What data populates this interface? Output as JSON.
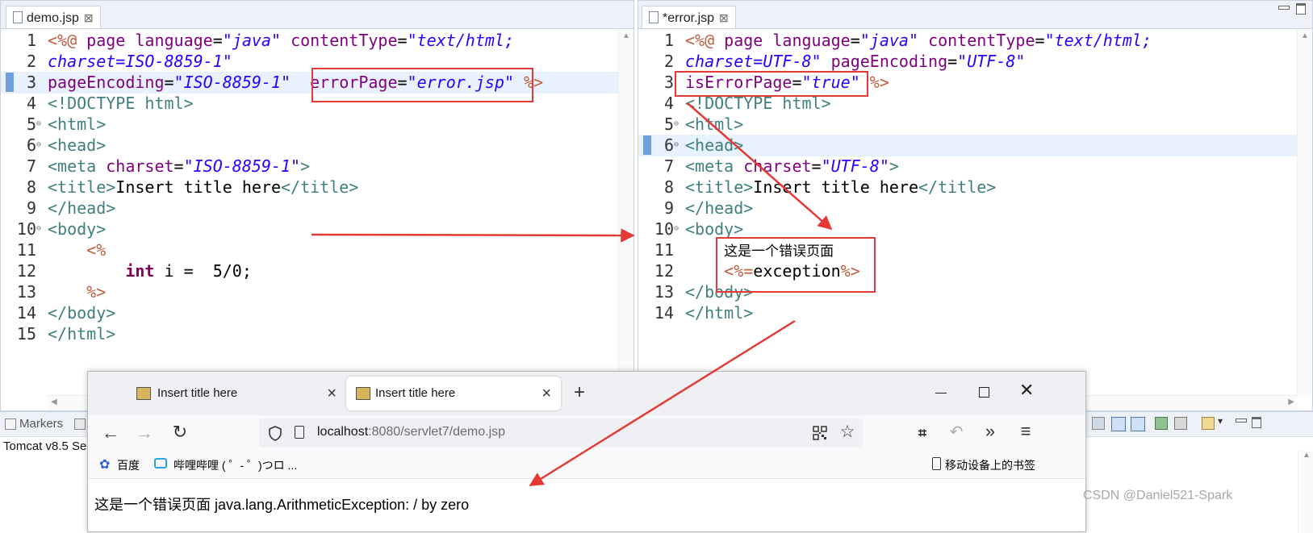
{
  "left_editor": {
    "tab_title": "demo.jsp",
    "lines": [
      {
        "n": "1",
        "parts": [
          [
            "d",
            "<%@ "
          ],
          [
            "a",
            "page "
          ],
          [
            "a",
            "language"
          ],
          [
            "p",
            "="
          ],
          [
            "s",
            "\"java\" "
          ],
          [
            "a",
            "contentType"
          ],
          [
            "p",
            "="
          ],
          [
            "s",
            "\"text/html;"
          ]
        ]
      },
      {
        "n": "2",
        "parts": [
          [
            "s",
            "charset=ISO-8859-1\""
          ]
        ]
      },
      {
        "n": "3",
        "parts": [
          [
            "a",
            "pageEncoding"
          ],
          [
            "p",
            "="
          ],
          [
            "s",
            "\"ISO-8859-1\"  "
          ],
          [
            "a",
            "errorPage"
          ],
          [
            "p",
            "="
          ],
          [
            "s",
            "\"error.jsp\" "
          ],
          [
            "d",
            "%>"
          ]
        ]
      },
      {
        "n": "4",
        "parts": [
          [
            "t",
            "<!DOCTYPE html>"
          ]
        ]
      },
      {
        "n": "5",
        "parts": [
          [
            "t",
            "<html>"
          ]
        ]
      },
      {
        "n": "6",
        "parts": [
          [
            "t",
            "<head>"
          ]
        ]
      },
      {
        "n": "7",
        "parts": [
          [
            "t",
            "<meta "
          ],
          [
            "a",
            "charset"
          ],
          [
            "p",
            "="
          ],
          [
            "s",
            "\"ISO-8859-1\""
          ],
          [
            "t",
            ">"
          ]
        ]
      },
      {
        "n": "8",
        "parts": [
          [
            "t",
            "<title>"
          ],
          [
            "p",
            "Insert title here"
          ],
          [
            "t",
            "</title>"
          ]
        ]
      },
      {
        "n": "9",
        "parts": [
          [
            "t",
            "</head>"
          ]
        ]
      },
      {
        "n": "10",
        "parts": [
          [
            "t",
            "<body>"
          ]
        ]
      },
      {
        "n": "11",
        "parts": [
          [
            "p",
            "    "
          ],
          [
            "d",
            "<%"
          ]
        ]
      },
      {
        "n": "12",
        "parts": [
          [
            "p",
            "        "
          ],
          [
            "k",
            "int"
          ],
          [
            "p",
            " i =  5/0;"
          ]
        ]
      },
      {
        "n": "13",
        "parts": [
          [
            "p",
            "    "
          ],
          [
            "d",
            "%>"
          ]
        ]
      },
      {
        "n": "14",
        "parts": [
          [
            "t",
            "</body>"
          ]
        ]
      },
      {
        "n": "15",
        "parts": [
          [
            "t",
            "</html>"
          ]
        ]
      }
    ]
  },
  "right_editor": {
    "tab_title": "*error.jsp",
    "lines": [
      {
        "n": "1",
        "parts": [
          [
            "d",
            "<%@ "
          ],
          [
            "a",
            "page "
          ],
          [
            "a",
            "language"
          ],
          [
            "p",
            "="
          ],
          [
            "s",
            "\"java\" "
          ],
          [
            "a",
            "contentType"
          ],
          [
            "p",
            "="
          ],
          [
            "s",
            "\"text/html;"
          ]
        ]
      },
      {
        "n": "2",
        "parts": [
          [
            "s",
            "charset=UTF-8\" "
          ],
          [
            "a",
            "pageEncoding"
          ],
          [
            "p",
            "="
          ],
          [
            "s",
            "\"UTF-8\""
          ]
        ]
      },
      {
        "n": "3",
        "parts": [
          [
            "a",
            "isErrorPage"
          ],
          [
            "p",
            "="
          ],
          [
            "s",
            "\"true\" "
          ],
          [
            "d",
            "%>"
          ]
        ]
      },
      {
        "n": "4",
        "parts": [
          [
            "t",
            "<!DOCTYPE html>"
          ]
        ]
      },
      {
        "n": "5",
        "parts": [
          [
            "t",
            "<html>"
          ]
        ]
      },
      {
        "n": "6",
        "parts": [
          [
            "t",
            "<head>"
          ]
        ]
      },
      {
        "n": "7",
        "parts": [
          [
            "t",
            "<meta "
          ],
          [
            "a",
            "charset"
          ],
          [
            "p",
            "="
          ],
          [
            "s",
            "\"UTF-8\""
          ],
          [
            "t",
            ">"
          ]
        ]
      },
      {
        "n": "8",
        "parts": [
          [
            "t",
            "<title>"
          ],
          [
            "p",
            "Insert title here"
          ],
          [
            "t",
            "</title>"
          ]
        ]
      },
      {
        "n": "9",
        "parts": [
          [
            "t",
            "</head>"
          ]
        ]
      },
      {
        "n": "10",
        "parts": [
          [
            "t",
            "<body>"
          ]
        ]
      },
      {
        "n": "11",
        "parts": [
          [
            "p",
            "    "
          ],
          [
            "cn",
            "这是一个错误页面"
          ]
        ]
      },
      {
        "n": "12",
        "parts": [
          [
            "p",
            "    "
          ],
          [
            "d",
            "<%="
          ],
          [
            "p",
            "exception"
          ],
          [
            "d",
            "%>"
          ]
        ]
      },
      {
        "n": "13",
        "parts": [
          [
            "t",
            "</body>"
          ]
        ]
      },
      {
        "n": "14",
        "parts": [
          [
            "t",
            "</html>"
          ]
        ]
      }
    ]
  },
  "bottom_panel": {
    "markers_tab": "Markers",
    "server_label": "Tomcat v8.5 Se"
  },
  "browser": {
    "tabs": [
      {
        "title": "Insert title here",
        "close": "×"
      },
      {
        "title": "Insert title here",
        "close": "×"
      }
    ],
    "new_tab": "+",
    "url_host": "localhost",
    "url_rest": ":8080/servlet7/demo.jsp",
    "bookmarks": [
      "百度",
      "哔哩哔哩 ( ゜- ゜)つロ ..."
    ],
    "mobile_bookmarks": "移动设备上的书签",
    "page_text": "这是一个错误页面 java.lang.ArithmeticException: / by zero"
  },
  "watermark": "CSDN @Daniel521-Spark",
  "colors": {
    "annotation_red": "#e53935"
  }
}
